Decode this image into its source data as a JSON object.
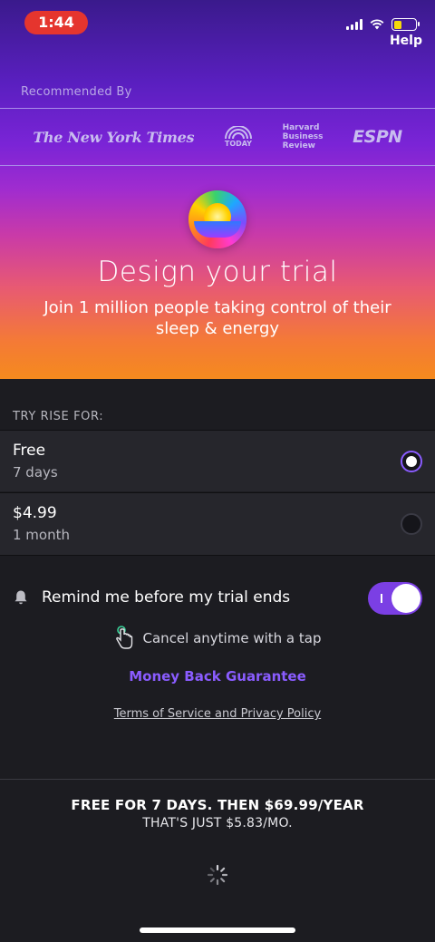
{
  "status_bar": {
    "time": "1:44",
    "help": "Help"
  },
  "press": {
    "recommended_label": "Recommended By",
    "logos": {
      "nyt": "The New York Times",
      "today": "TODAY",
      "hbr_line1": "Harvard",
      "hbr_line2": "Business",
      "hbr_line3": "Review",
      "espn": "ESPN"
    }
  },
  "hero": {
    "title": "Design your trial",
    "subtitle": "Join 1 million people taking control of their sleep & energy"
  },
  "trial": {
    "section_label": "TRY RISE FOR:",
    "options": [
      {
        "name": "Free",
        "duration": "7 days",
        "selected": true
      },
      {
        "name": "$4.99",
        "duration": "1 month",
        "selected": false
      }
    ]
  },
  "reminder": {
    "label": "Remind me before my trial ends",
    "enabled": true
  },
  "cancel": {
    "label": "Cancel anytime with a tap"
  },
  "guarantee": {
    "label": "Money Back Guarantee"
  },
  "legal": {
    "label": "Terms of Service and Privacy Policy"
  },
  "offer": {
    "line1": "FREE FOR 7 DAYS. THEN $69.99/YEAR",
    "line2": "THAT'S JUST $5.83/MO."
  },
  "colors": {
    "accent": "#8a5cff",
    "toggle_on": "#7b3fe4",
    "status_pill": "#e5352e"
  }
}
